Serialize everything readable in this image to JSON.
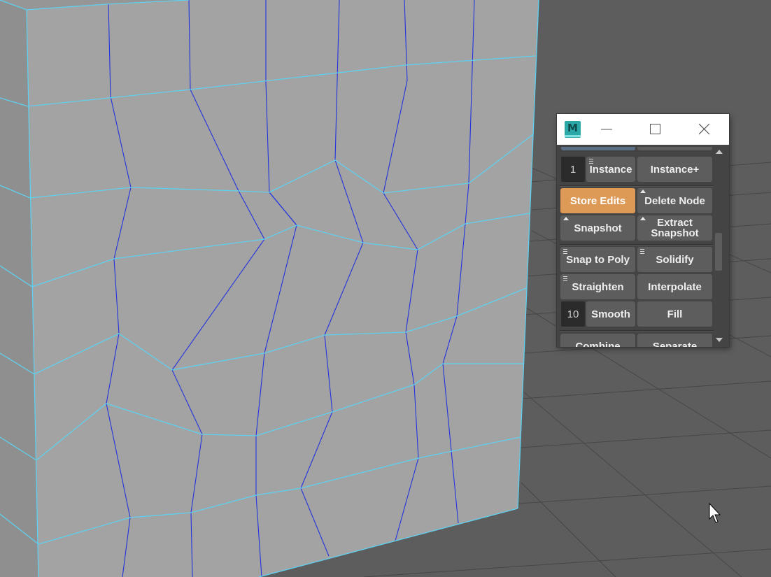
{
  "app": {
    "icon_letter": "M",
    "icon": "maya-icon"
  },
  "window_controls": {
    "minimize": "minimize-icon",
    "maximize": "maximize-icon",
    "close": "close-icon"
  },
  "tool_buttons": {
    "instance_count": "1",
    "instance": "Instance",
    "instance_plus": "Instance+",
    "store_edits": "Store Edits",
    "delete_node": "Delete Node",
    "snapshot": "Snapshot",
    "extract_snapshot_line1": "Extract",
    "extract_snapshot_line2": "Snapshot",
    "snap_to_poly": "Snap to Poly",
    "solidify": "Solidify",
    "straighten": "Straighten",
    "interpolate": "Interpolate",
    "smooth_count": "10",
    "smooth": "Smooth",
    "fill": "Fill",
    "combine": "Combine",
    "separate": "Separate"
  },
  "colors": {
    "active_button": "#dd9a56",
    "wire_edges": "#5fd0ef",
    "inner_edges": "#2233dd",
    "mesh_face": "#a3a3a3",
    "viewport_bg": "#5d5d5d"
  },
  "cursor": "arrow-cursor-icon"
}
